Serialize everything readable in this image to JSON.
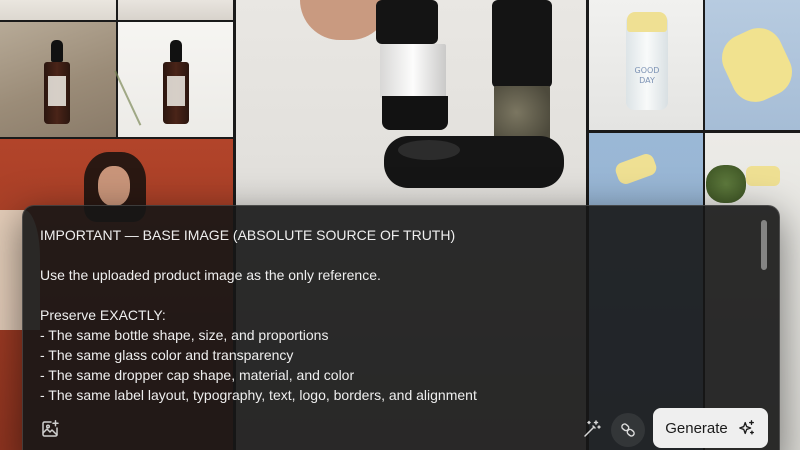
{
  "background": {
    "jar_label": "GOOD\nDAY"
  },
  "prompt": {
    "lines": [
      "IMPORTANT — BASE IMAGE (ABSOLUTE SOURCE OF TRUTH)",
      "",
      "Use the uploaded product image as the only reference.",
      "",
      "Preserve EXACTLY:",
      "- The same bottle shape, size, and proportions",
      "- The same glass color and transparency",
      "- The same dropper cap shape, material, and color",
      "- The same label layout, typography, text, logo, borders, and alignment"
    ]
  },
  "toolbar": {
    "add_image_icon": "image-plus-icon",
    "enhance_icon": "magic-wand-icon",
    "reference_icon": "link-icon",
    "generate_label": "Generate",
    "generate_icon": "sparkles-icon"
  }
}
